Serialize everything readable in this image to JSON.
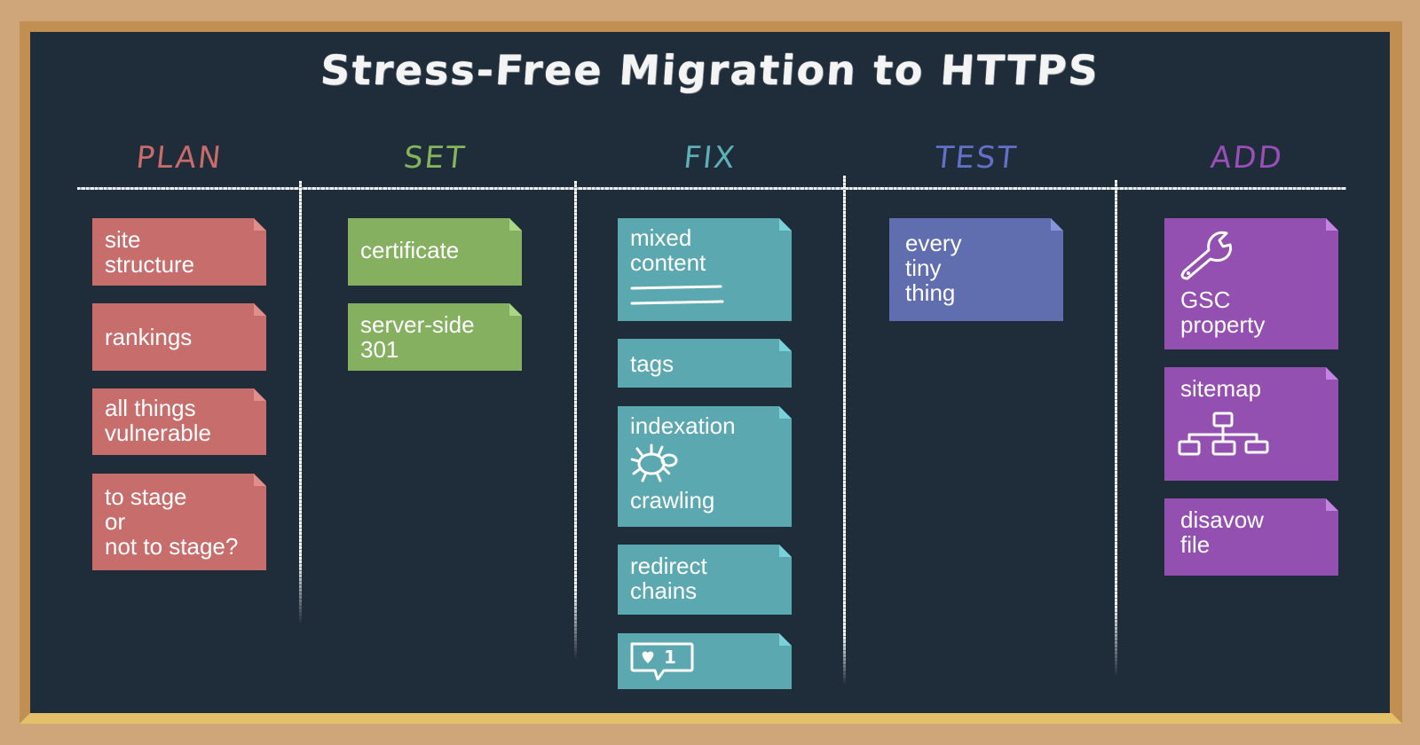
{
  "title": "Stress-Free Migration to HTTPS",
  "colors": {
    "plan": "#c76d6c",
    "set": "#84b060",
    "fix": "#5ca8b0",
    "test": "#606eb0",
    "add": "#9350b0",
    "board": "#1f2c3a",
    "frame": "#cfa67a"
  },
  "columns": [
    {
      "heading": "PLAN",
      "cards": [
        {
          "text": "site\nstructure"
        },
        {
          "text": "rankings"
        },
        {
          "text": "all things\nvulnerable"
        },
        {
          "text": "to stage\nor\nnot to stage?"
        }
      ]
    },
    {
      "heading": "SET",
      "cards": [
        {
          "text": "certificate"
        },
        {
          "text": "server-side\n301"
        }
      ]
    },
    {
      "heading": "FIX",
      "cards": [
        {
          "text": "mixed\ncontent",
          "icon": "strikethrough-lines-icon"
        },
        {
          "text": "tags"
        },
        {
          "text": "indexation",
          "icon": "crawler-bug-icon",
          "text2": "crawling"
        },
        {
          "text": "redirect\nchains"
        },
        {
          "icon": "social-like-notification-icon",
          "badge": "1"
        }
      ]
    },
    {
      "heading": "TEST",
      "cards": [
        {
          "text": "every\ntiny\nthing"
        }
      ]
    },
    {
      "heading": "ADD",
      "cards": [
        {
          "icon": "wrench-icon",
          "text": "GSC\nproperty"
        },
        {
          "text": "sitemap",
          "icon": "sitemap-hierarchy-icon"
        },
        {
          "text": "disavow\nfile"
        }
      ]
    }
  ]
}
